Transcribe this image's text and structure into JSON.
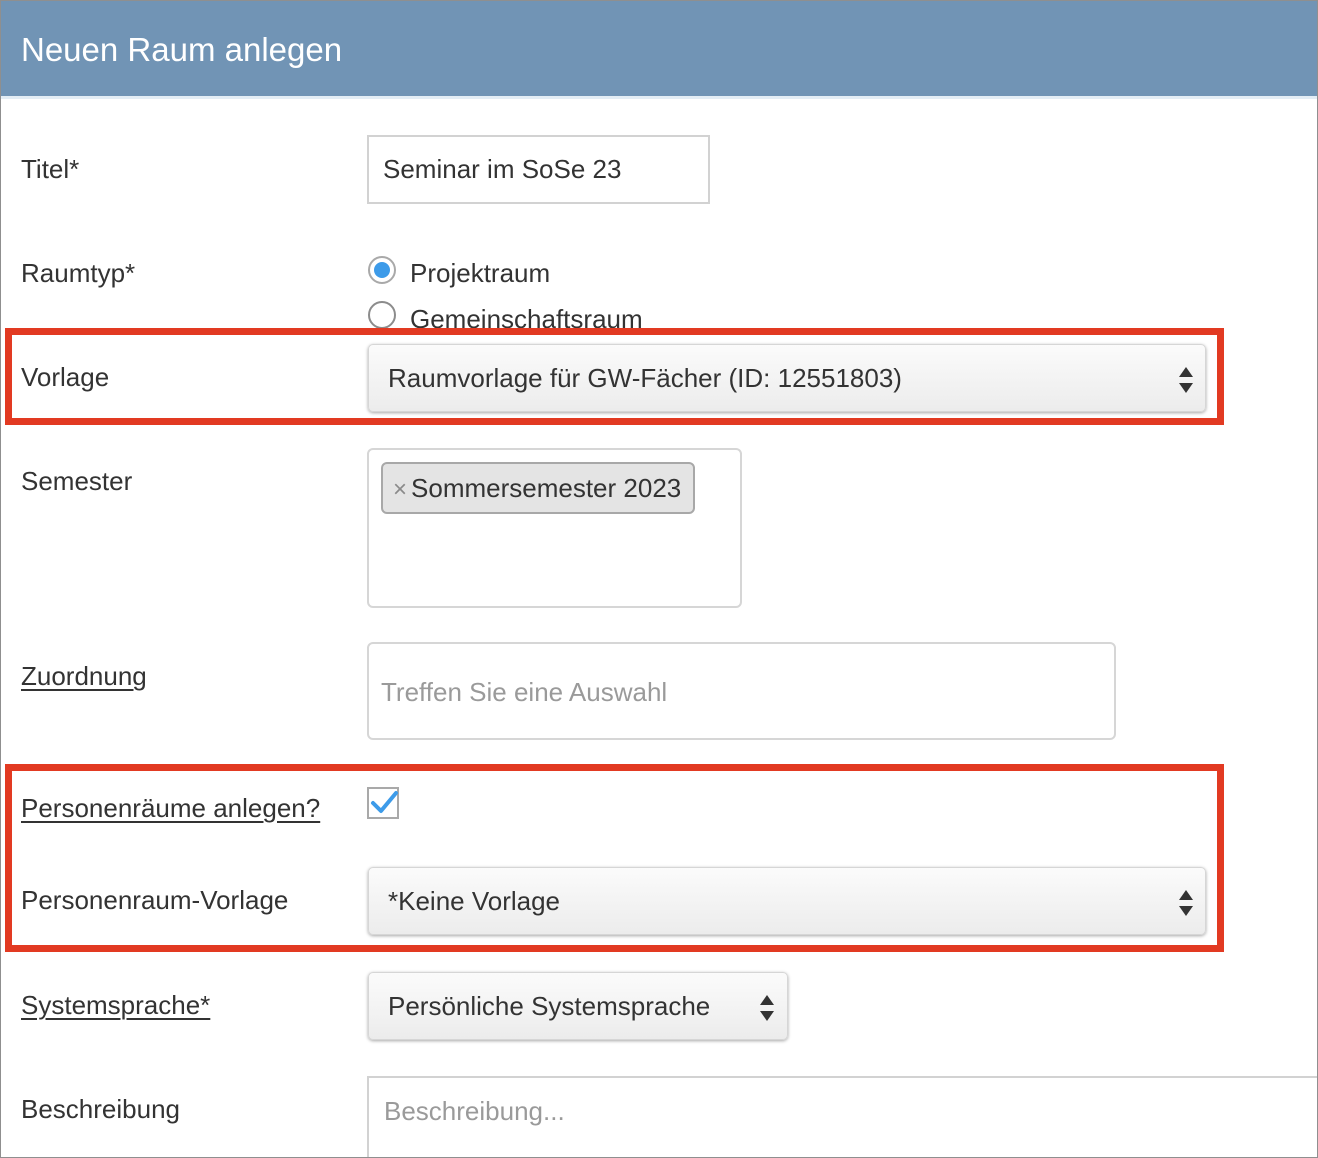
{
  "header": {
    "title": "Neuen Raum anlegen"
  },
  "form": {
    "title": {
      "label": "Titel*",
      "value": "Seminar im SoSe 23"
    },
    "room_type": {
      "label": "Raumtyp*",
      "options": [
        {
          "label": "Projektraum",
          "checked": true
        },
        {
          "label": "Gemeinschaftsraum",
          "checked": false
        }
      ]
    },
    "template": {
      "label": "Vorlage",
      "value": "Raumvorlage für GW-Fächer (ID: 12551803)"
    },
    "semester": {
      "label": "Semester",
      "tags": [
        "Sommersemester 2023"
      ],
      "remove_symbol": "×"
    },
    "assignment": {
      "label": "Zuordnung",
      "placeholder": "Treffen Sie eine Auswahl"
    },
    "person_rooms": {
      "label": "Personenräume anlegen?",
      "checked": true
    },
    "person_room_template": {
      "label": "Personenraum-Vorlage",
      "value": "*Keine Vorlage"
    },
    "system_language": {
      "label": "Systemsprache*",
      "value": "Persönliche Systemsprache"
    },
    "description": {
      "label": "Beschreibung",
      "placeholder": "Beschreibung..."
    }
  },
  "colors": {
    "header_bg": "#7194b5",
    "highlight": "#e23a22",
    "accent": "#3d9be9"
  }
}
